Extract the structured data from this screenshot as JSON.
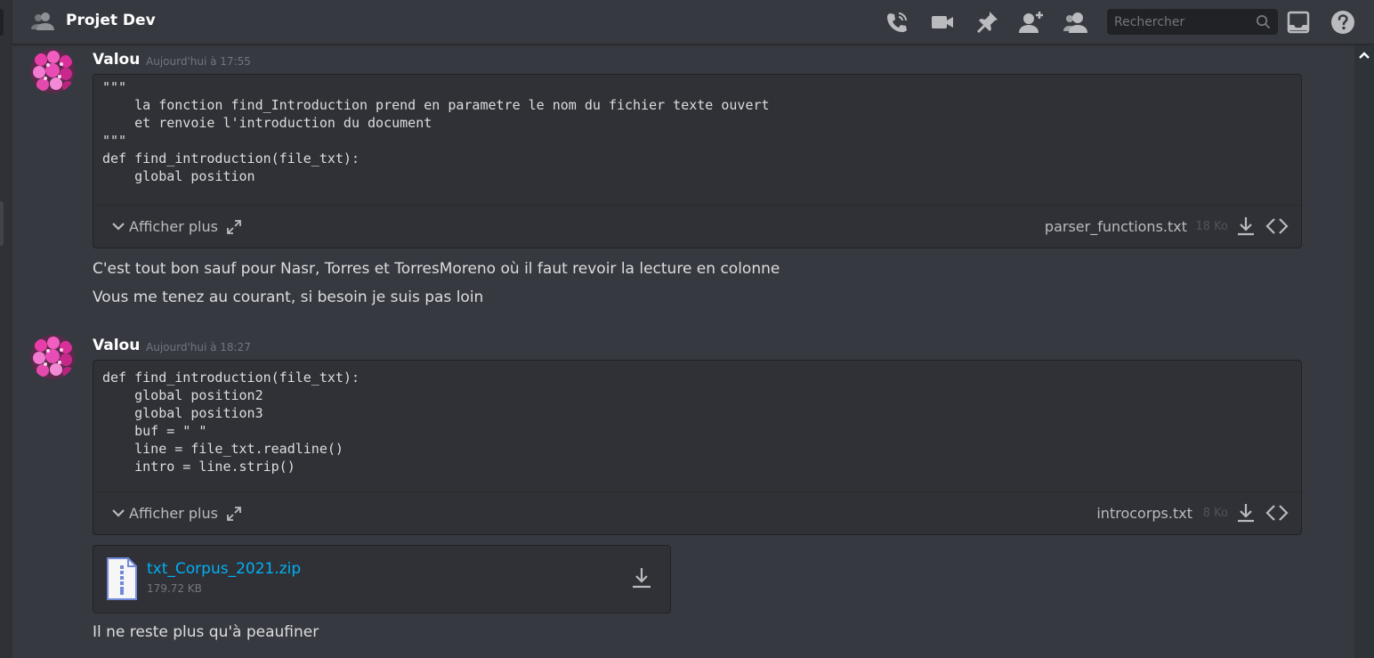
{
  "header": {
    "channel_title": "Projet Dev",
    "search_placeholder": "Rechercher"
  },
  "messages": [
    {
      "username": "Valou",
      "timestamp": "Aujourd'hui à 17:55",
      "code_file": {
        "code": "\"\"\"\n    la fonction find_Introduction prend en parametre le nom du fichier texte ouvert\n    et renvoie l'introduction du document\n\"\"\"\ndef find_introduction(file_txt):\n    global position",
        "more_label": "Afficher plus",
        "filename": "parser_functions.txt",
        "filesize": "18 Ko"
      },
      "texts": [
        "C'est tout bon sauf pour Nasr, Torres et TorresMoreno où il faut revoir la lecture en colonne",
        "Vous me tenez au courant, si besoin je suis pas loin"
      ]
    },
    {
      "username": "Valou",
      "timestamp": "Aujourd'hui à 18:27",
      "code_file": {
        "code": "def find_introduction(file_txt):\n    global position2\n    global position3\n    buf = \" \"\n    line = file_txt.readline()\n    intro = line.strip()",
        "more_label": "Afficher plus",
        "filename": "introcorps.txt",
        "filesize": "8 Ko"
      },
      "attachment": {
        "filename": "txt_Corpus_2021.zip",
        "filesize": "179.72 KB"
      },
      "texts": [
        "Il ne reste plus qu'à peaufiner"
      ]
    }
  ],
  "icons": [
    "people-icon",
    "call-icon",
    "video-icon",
    "pin-icon",
    "add-member-icon",
    "member-list-icon",
    "search-icon",
    "inbox-icon",
    "help-icon",
    "download-icon",
    "code-view-icon",
    "expand-icon",
    "chevron-down-icon",
    "zip-file-icon"
  ],
  "colors": {
    "background": "#36393f",
    "code_background": "#2f3136",
    "link": "#00b0f4",
    "header_title": "#ffffff",
    "muted": "#72767d"
  }
}
